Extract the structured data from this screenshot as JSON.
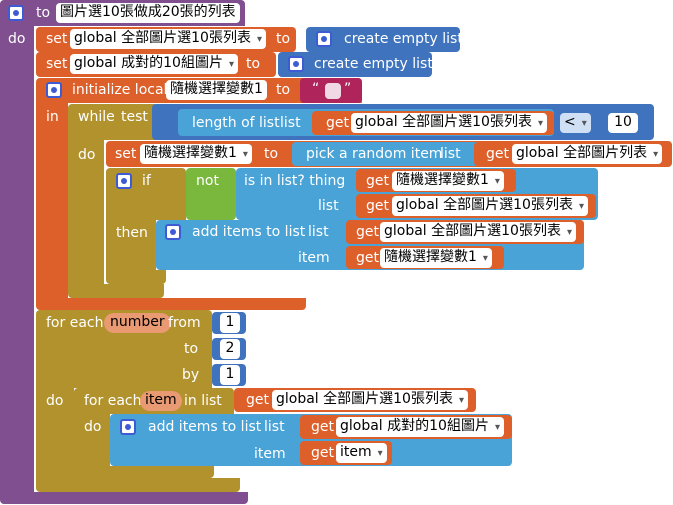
{
  "procedure": {
    "to": "to",
    "name": "圖片選10張做成20張的列表",
    "do": "do"
  },
  "set1": {
    "set": "set",
    "var": "global 全部圖片選10張列表",
    "to": "to",
    "value": "create empty list"
  },
  "set2": {
    "set": "set",
    "var": "global 成對的10組圖片",
    "to": "to",
    "value": "create empty list"
  },
  "init": {
    "label": "initialize local",
    "var": "隨機選擇變數1",
    "to": "to",
    "str_open": "“",
    "str_close": "”",
    "in": "in"
  },
  "while": {
    "label": "while",
    "test": "test",
    "length": "length of list",
    "list": "list",
    "get": "get",
    "var": "global 全部圖片選10張列表",
    "op": "<",
    "num": "10",
    "do": "do"
  },
  "set3": {
    "set": "set",
    "var": "隨機選擇變數1",
    "to": "to",
    "pick": "pick a random item",
    "list": "list",
    "get": "get",
    "list_var": "global 全部圖片列表"
  },
  "if": {
    "if": "if",
    "not": "not",
    "is_in": "is in list? thing",
    "list": "list",
    "get1": "get",
    "var1": "隨機選擇變數1",
    "get2": "get",
    "var2": "global 全部圖片選10張列表",
    "then": "then"
  },
  "add1": {
    "label": "add items to list",
    "list": "list",
    "get1": "get",
    "var1": "global 全部圖片選10張列表",
    "item": "item",
    "get2": "get",
    "var2": "隨機選擇變數1"
  },
  "for_num": {
    "label": "for each",
    "var": "number",
    "from": "from",
    "from_val": "1",
    "to": "to",
    "to_val": "2",
    "by": "by",
    "by_val": "1",
    "do": "do"
  },
  "for_item": {
    "label": "for each",
    "var": "item",
    "in_list": "in list",
    "get": "get",
    "list_var": "global 全部圖片選10張列表",
    "do": "do"
  },
  "add2": {
    "label": "add items to list",
    "list": "list",
    "get1": "get",
    "var1": "global 成對的10組圖片",
    "item": "item",
    "get2": "get",
    "var2": "item"
  }
}
